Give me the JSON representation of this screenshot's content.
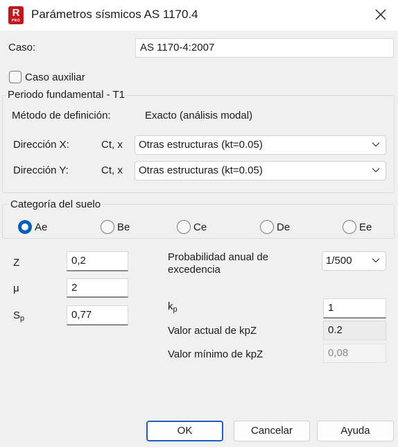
{
  "window": {
    "title": "Parámetros sísmicos AS 1170.4",
    "app_icon_letter": "R",
    "app_icon_badge": "PRO"
  },
  "caso": {
    "label": "Caso:",
    "value": "AS 1170-4:2007"
  },
  "caso_auxiliar": {
    "label": "Caso auxiliar",
    "checked": false
  },
  "periodo": {
    "legend": "Periodo fundamental - T1",
    "metodo_label": "Método de definición:",
    "metodo_value": "Exacto (análisis modal)",
    "dir_x": {
      "label": "Dirección X:",
      "param": "Ct, x",
      "value": "Otras estructuras (kt=0.05)"
    },
    "dir_y": {
      "label": "Dirección Y:",
      "param": "Ct, x",
      "value": "Otras estructuras (kt=0.05)"
    }
  },
  "suelo": {
    "legend": "Categoría del suelo",
    "options": [
      "Ae",
      "Be",
      "Ce",
      "De",
      "Ee"
    ],
    "selected": "Ae"
  },
  "params": {
    "z": {
      "label": "Z",
      "value": "0,2"
    },
    "mu": {
      "label": "μ",
      "value": "2"
    },
    "sp": {
      "label_main": "S",
      "label_sub": "p",
      "value": "0,77"
    }
  },
  "probabilidad": {
    "label_line1": "Probabilidad anual de",
    "label_line2": "excedencia",
    "value": "1/500"
  },
  "kp": {
    "label_main": "k",
    "label_sub": "p",
    "value": "1"
  },
  "kpz_actual": {
    "label": "Valor actual de kpZ",
    "value": "0.2"
  },
  "kpz_minimo": {
    "label": "Valor mínimo de kpZ",
    "value": "0,08"
  },
  "buttons": {
    "ok": "OK",
    "cancel": "Cancelar",
    "help": "Ayuda"
  },
  "colors": {
    "accent": "#005fb8",
    "default_button_border": "#1b62c0",
    "app_icon": "#c4161c"
  }
}
